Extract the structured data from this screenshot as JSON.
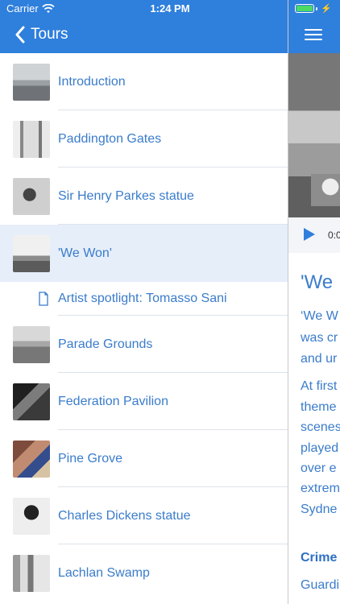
{
  "status": {
    "carrier": "Carrier",
    "time": "1:24 PM"
  },
  "nav": {
    "back_label": "Tours"
  },
  "list": {
    "items": [
      {
        "label": "Introduction"
      },
      {
        "label": "Paddington Gates"
      },
      {
        "label": "Sir Henry Parkes statue"
      },
      {
        "label": "'We Won'"
      },
      {
        "label": "Artist spotlight: Tomasso Sani"
      },
      {
        "label": "Parade Grounds"
      },
      {
        "label": "Federation Pavilion"
      },
      {
        "label": "Pine Grove"
      },
      {
        "label": "Charles Dickens statue"
      },
      {
        "label": "Lachlan Swamp"
      }
    ],
    "selected_index": 3
  },
  "detail": {
    "player_time": "0:0",
    "title": "'We",
    "paragraph1_lines": [
      "‘We W",
      "was cr",
      "and ur"
    ],
    "paragraph2_lines": [
      "At first",
      "theme",
      "scenes",
      "played",
      "over e",
      "extrem",
      "Sydne"
    ],
    "subheading": "Crime",
    "subtext": "Guardi"
  },
  "colors": {
    "accent": "#2f7fdc",
    "link": "#3a7ccb",
    "selected_row": "#e6eefa"
  }
}
